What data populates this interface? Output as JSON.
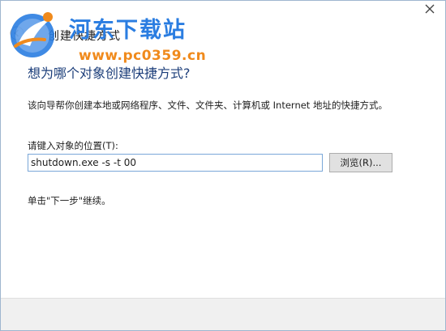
{
  "window": {
    "wizard_title": "创建快捷方式"
  },
  "watermark": {
    "site_name": "河东下载站",
    "url": "www.pc0359.cn"
  },
  "main": {
    "heading": "想为哪个对象创建快捷方式?",
    "description": "该向导帮你创建本地或网络程序、文件、文件夹、计算机或 Internet 地址的快捷方式。",
    "field_label": "请键入对象的位置(T):",
    "location_value": "shutdown.exe -s -t 00",
    "browse_label": "浏览(R)...",
    "hint": "单击\"下一步\"继续。"
  },
  "colors": {
    "heading": "#1c3e7a",
    "watermark_blue": "#2a7de1",
    "watermark_orange": "#f08a1c",
    "close_icon": "#444444",
    "footer_bg": "#f0f0f0"
  },
  "icons": {
    "close": "close-icon",
    "back": "back-arrow-icon",
    "logo": "watermark-logo-icon"
  }
}
